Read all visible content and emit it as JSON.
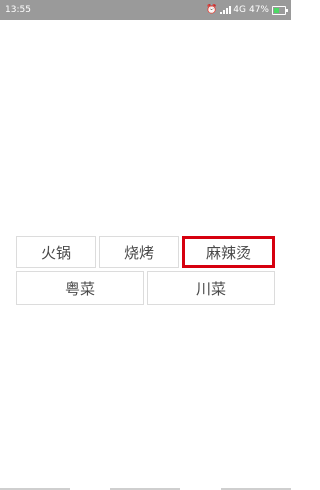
{
  "status_bar": {
    "time": "13:55",
    "network": "4G",
    "battery_percent": "47%",
    "battery_level": 0.47
  },
  "tags": {
    "row1": [
      {
        "label": "火锅",
        "selected": false
      },
      {
        "label": "烧烤",
        "selected": false
      },
      {
        "label": "麻辣烫",
        "selected": true
      }
    ],
    "row2": [
      {
        "label": "粤菜",
        "selected": false
      },
      {
        "label": "川菜",
        "selected": false
      }
    ]
  },
  "colors": {
    "status_bar_bg": "#9a9a9a",
    "selected_border": "#d6000e",
    "tag_border": "#dcdcdc",
    "tag_text": "#4a4a4a"
  }
}
